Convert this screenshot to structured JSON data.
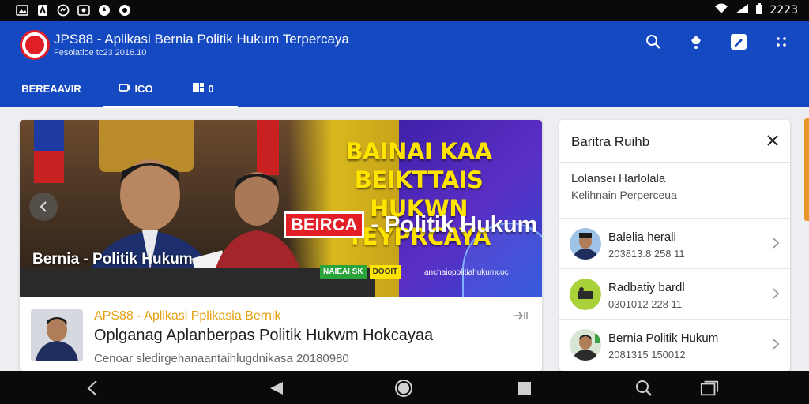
{
  "status_bar": {
    "time": "2223",
    "notification_icons": [
      "gallery-icon",
      "app-icon",
      "messenger-icon",
      "photo-icon",
      "compass-icon",
      "record-icon"
    ]
  },
  "app": {
    "title": "JPS88 - Aplikasi Bernia Politik Hukum Terpercaya",
    "subtitle": "Fesolatioe tc23 2016.10",
    "brand_color": "#1549c2",
    "accent_red": "#e21f26"
  },
  "tabs": [
    {
      "label": "BEREAAVIR"
    },
    {
      "label": "ICO"
    },
    {
      "label": "0"
    }
  ],
  "hero": {
    "headline_line1": "BAINAI KAA BEIKTTAIS",
    "headline_line2": "HUKWN TEYPRCAYA",
    "tag_box": "BEIRCA",
    "tag_text": "- Politik Hukum",
    "caption": "Bernia - Politik Hukum",
    "small_tag_green": "NAIEAI SK",
    "small_tag_yellow": "DOOIT",
    "url_text": "anchaiopolitiahukumcoc"
  },
  "article": {
    "kicker": "APS88 - Aplikasi Pplikasia Bernik",
    "title": "Oplganag Aplanberpas Politik Hukwm  Hokcayaa",
    "subtitle": "Cenoar sledirgehanaantaihlugdnikasa 20180980"
  },
  "side_panel": {
    "title": "Baritra Ruihb",
    "desc_line1": "Lolansei Harlolala",
    "desc_line2": "Kelihnain Perperceua",
    "items": [
      {
        "title": "Balelia herali",
        "time": "203813.8 258 11"
      },
      {
        "title": "Radbatiy bardl",
        "time": "0301012 228 11"
      },
      {
        "title": "Bernia Politik Hukum",
        "time": "2081315 150012"
      }
    ]
  }
}
